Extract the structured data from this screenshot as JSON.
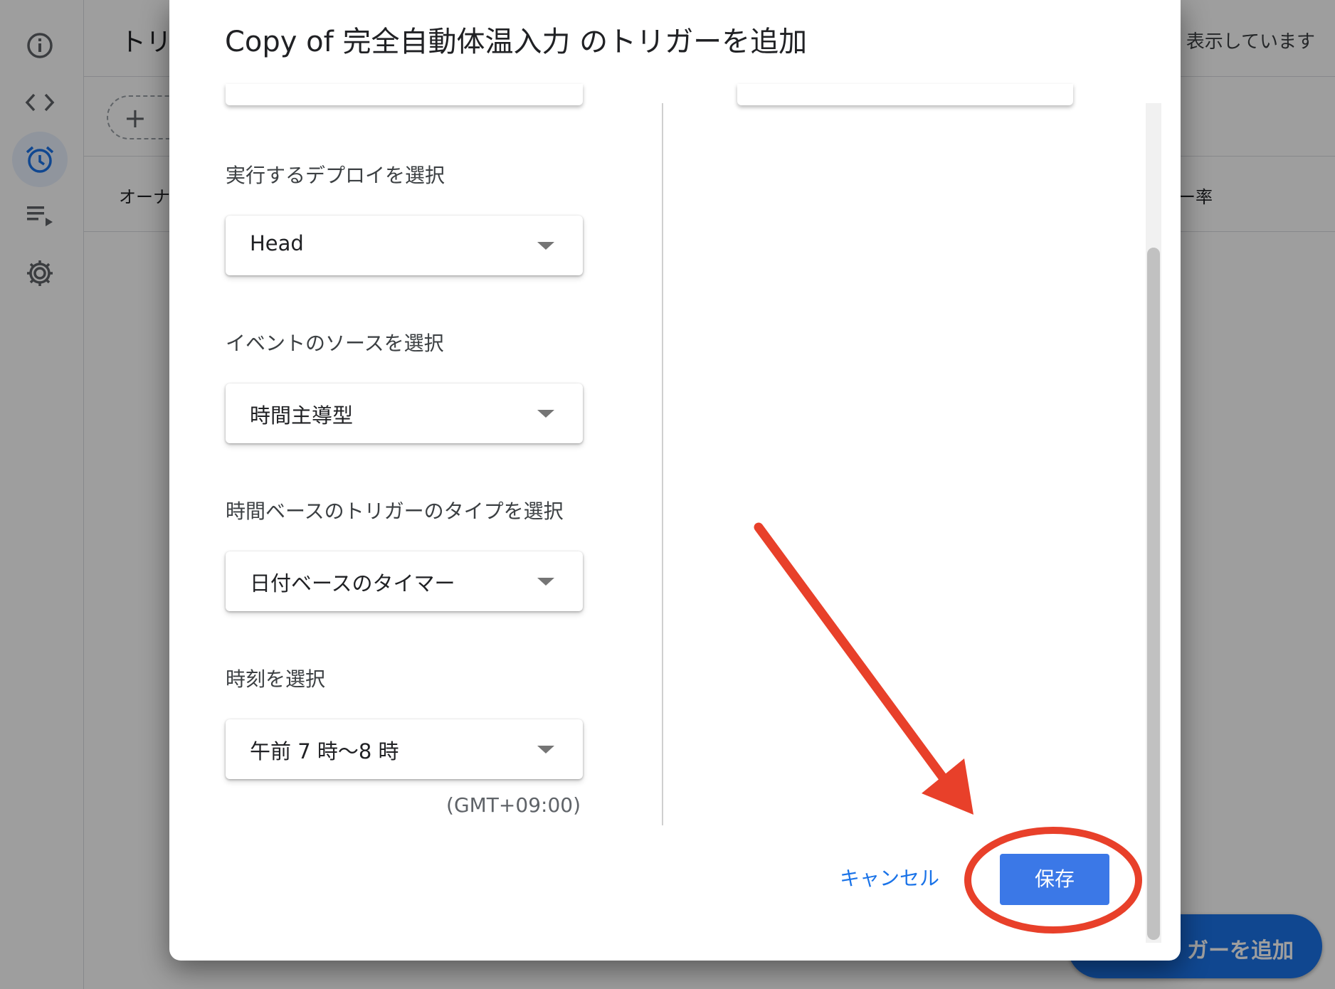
{
  "background": {
    "title": "トリ",
    "showing_text": "表示しています",
    "owner_header": "オーナ",
    "rate_header": "ー率",
    "fab_label": "ガーを追加"
  },
  "sidebar": {
    "items": [
      {
        "icon": "info-icon"
      },
      {
        "icon": "code-icon"
      },
      {
        "icon": "alarm-clock-icon",
        "active": true
      },
      {
        "icon": "executions-icon"
      },
      {
        "icon": "gear-icon"
      }
    ]
  },
  "dialog": {
    "title": "Copy of 完全自動体温入力 のトリガーを追加",
    "fields": [
      {
        "label": "実行するデプロイを選択",
        "value": "Head"
      },
      {
        "label": "イベントのソースを選択",
        "value": "時間主導型"
      },
      {
        "label": "時間ベースのトリガーのタイプを選択",
        "value": "日付ベースのタイマー"
      },
      {
        "label": "時刻を選択",
        "value": "午前 7 時〜8 時"
      }
    ],
    "timezone": "(GMT+09:00)",
    "cancel_label": "キャンセル",
    "save_label": "保存"
  },
  "colors": {
    "primary": "#1a73e8",
    "save_button": "#3b78e7",
    "annotation_red": "#e8402a"
  }
}
